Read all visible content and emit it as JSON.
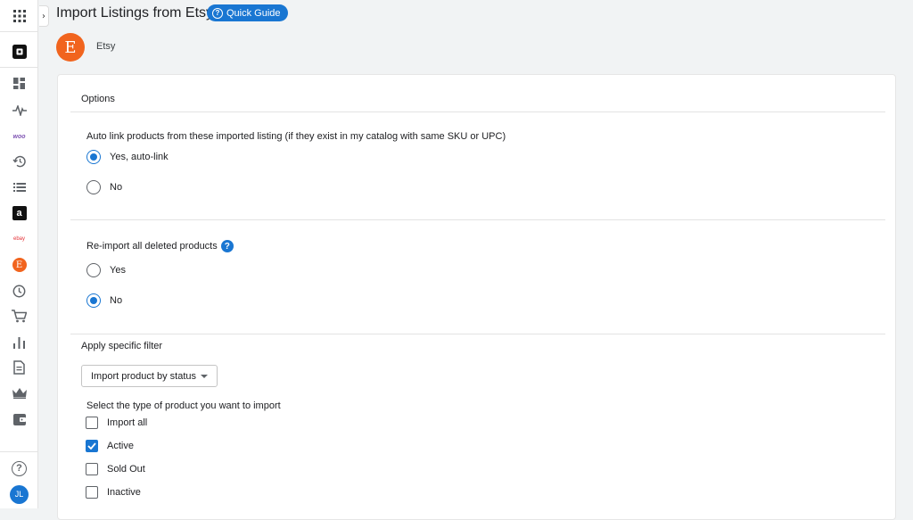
{
  "header": {
    "title": "Import Listings from Etsy",
    "quick_guide": "Quick Guide",
    "expand_chevron": "›"
  },
  "channel": {
    "logo_letter": "E",
    "name": "Etsy"
  },
  "sidebar": {
    "icons": [
      "apps-icon",
      "square-logo-icon",
      "dashboard-icon",
      "activity-icon",
      "woo-icon",
      "history-icon",
      "list-icon",
      "amazon-icon",
      "ebay-icon",
      "etsy-icon",
      "clock-icon",
      "cart-icon",
      "bar-chart-icon",
      "document-icon",
      "crown-icon",
      "wallet-icon",
      "help-icon"
    ],
    "woo_label": "woo",
    "ebay_label": "ebay",
    "amazon_label": "a",
    "etsy_label": "E",
    "help_label": "?",
    "avatar_initials": "JL"
  },
  "options": {
    "title": "Options",
    "auto_link": {
      "label": "Auto link products from these imported listing (if they exist in my catalog with same SKU or UPC)",
      "choices": [
        {
          "label": "Yes, auto-link",
          "selected": true
        },
        {
          "label": "No",
          "selected": false
        }
      ]
    },
    "reimport": {
      "label": "Re-import all deleted products",
      "help": "?",
      "choices": [
        {
          "label": "Yes",
          "selected": false
        },
        {
          "label": "No",
          "selected": true
        }
      ]
    }
  },
  "filter": {
    "title": "Apply specific filter",
    "select_value": "Import product by status",
    "type_label": "Select the type of product you want to import",
    "statuses": [
      {
        "label": "Import all",
        "checked": false
      },
      {
        "label": "Active",
        "checked": true
      },
      {
        "label": "Sold Out",
        "checked": false
      },
      {
        "label": "Inactive",
        "checked": false
      }
    ]
  },
  "colors": {
    "accent": "#1976d2",
    "etsy": "#f1641e",
    "woo": "#7f54b3"
  }
}
